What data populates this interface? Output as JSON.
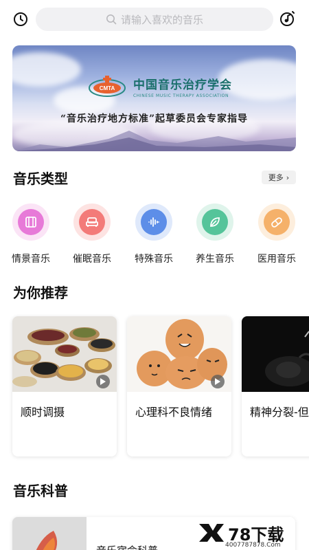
{
  "search": {
    "placeholder": "请输入喜欢的音乐"
  },
  "banner": {
    "logo_badge": "CMTA",
    "org_name": "中国音乐治疗学会",
    "org_name_en": "CHINESE MUSIC THERAPY ASSOCIATION",
    "slogan": "“音乐治疗地方标准”起草委员会专家指导"
  },
  "music_types": {
    "title": "音乐类型",
    "more_label": "更多",
    "items": [
      {
        "label": "情景音乐",
        "icon": "scene-icon",
        "color": "#e77ad8",
        "bg": "#fbe4f6"
      },
      {
        "label": "催眠音乐",
        "icon": "bed-icon",
        "color": "#f37b79",
        "bg": "#fde3e2"
      },
      {
        "label": "特殊音乐",
        "icon": "soundwave-icon",
        "color": "#5d8ee8",
        "bg": "#dfe9fb"
      },
      {
        "label": "养生音乐",
        "icon": "leaf-icon",
        "color": "#55c49a",
        "bg": "#dff4eb"
      },
      {
        "label": "医用音乐",
        "icon": "pill-icon",
        "color": "#f5b16a",
        "bg": "#fdeedd"
      }
    ]
  },
  "recommend": {
    "title": "为你推荐",
    "items": [
      {
        "title": "顺时调摄",
        "image": "grains-image"
      },
      {
        "title": "心理科不良情绪",
        "image": "eggs-faces-image"
      },
      {
        "title": "精神分裂-但",
        "image": "dark-figure-image"
      }
    ]
  },
  "science": {
    "title": "音乐科普",
    "items": [
      {
        "title": "音乐宿命科普"
      }
    ]
  },
  "watermark": {
    "brand": "78下载",
    "url": "4007787878.Com"
  }
}
